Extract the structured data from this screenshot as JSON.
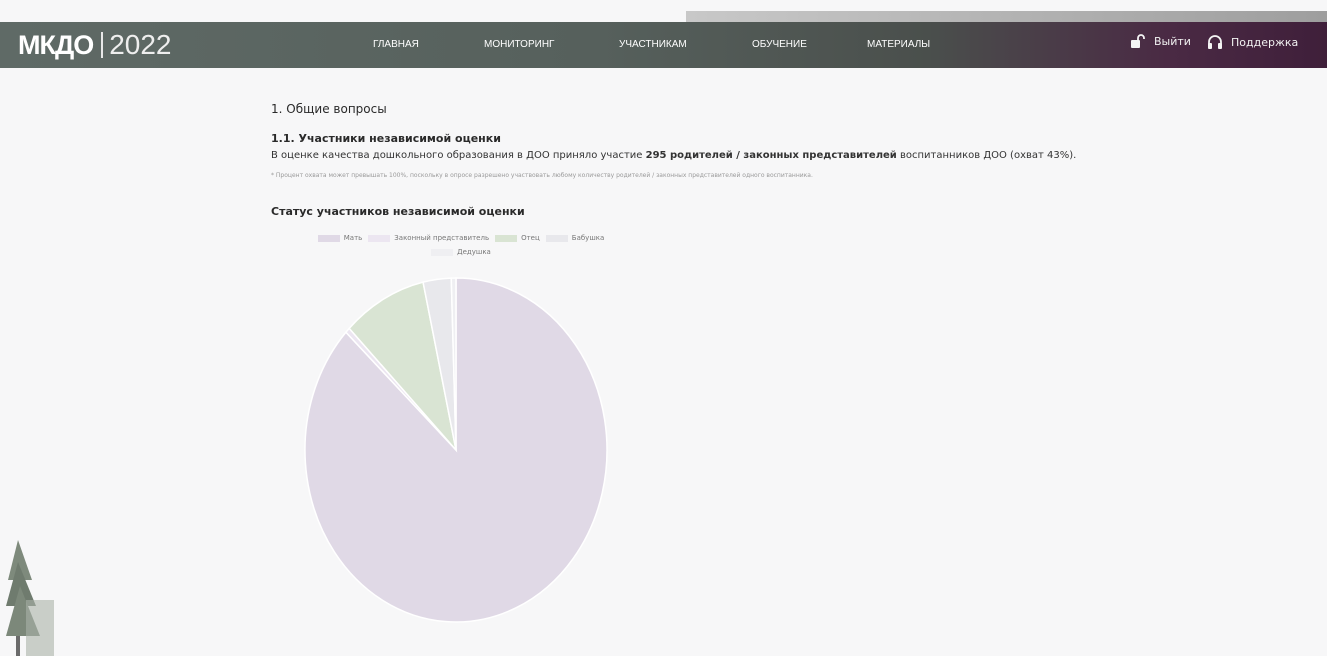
{
  "header": {
    "logo": "МКДО",
    "year": "2022",
    "nav": [
      "ГЛАВНАЯ",
      "МОНИТОРИНГ",
      "УЧАСТНИКАМ",
      "ОБУЧЕНИЕ",
      "МАТЕРИАЛЫ"
    ],
    "logout": "Выйти",
    "support": "Поддержка"
  },
  "content": {
    "section_title": "1. Общие вопросы",
    "subsection_title": "1.1. Участники независимой оценки",
    "text_before": "В оценке качества дошкольного образования в ДОО приняло участие ",
    "text_bold": "295 родителей / законных представителей",
    "text_after": " воспитанников ДОО (охват 43%).",
    "note": "* Процент охвата может превышать 100%, поскольку в опросе разрешено участвовать любому количеству родителей / законных представителей одного воспитанника.",
    "chart_title": "Статус участников независимой оценки"
  },
  "chart_data": {
    "type": "pie",
    "labels": [
      "Мать",
      "Законный представитель",
      "Отец",
      "Бабушка",
      "Дедушка"
    ],
    "values": [
      87,
      0.5,
      9,
      3,
      0.5
    ],
    "colors": [
      "#e0d9e6",
      "#ece6f1",
      "#d9e4d3",
      "#e8e8ec",
      "#efeff2"
    ]
  },
  "icons": {
    "logout": "lock-open-icon",
    "support": "headset-icon"
  },
  "colors": {
    "header_start": "#5f6a66",
    "header_end": "#3f1f3a",
    "background": "#f7f7f8"
  }
}
